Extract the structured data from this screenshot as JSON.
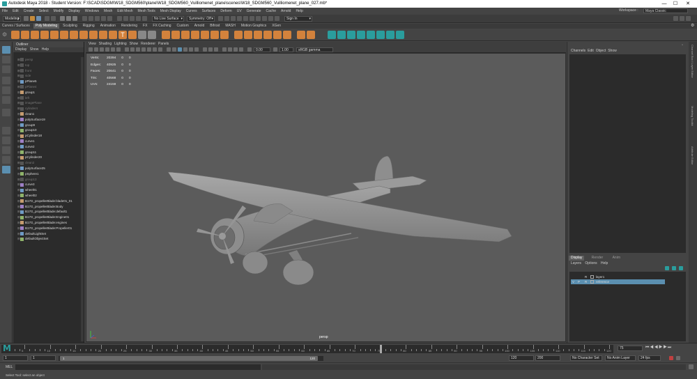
{
  "window": {
    "title": "Autodesk Maya 2018 - Student Version: F:\\SCAD\\SDGM\\W18_SDGM560\\plane\\W18_SDGM560_Vuilliomenet_plane\\scenes\\W18_SDGM560_Vuilliomenet_plane_027.mb*",
    "minimize": "—",
    "maximize": "☐",
    "close": "✕"
  },
  "menubar": [
    "File",
    "Edit",
    "Create",
    "Select",
    "Modify",
    "Display",
    "Windows",
    "Mesh",
    "Edit Mesh",
    "Mesh Tools",
    "Mesh Display",
    "Curves",
    "Surfaces",
    "Deform",
    "UV",
    "Generate",
    "Cache",
    "Arnold",
    "Help"
  ],
  "workspace": {
    "label": "Workspace :",
    "value": "Maya Classic"
  },
  "statusline": {
    "menuset": "Modeling",
    "live_surface": "No Live Surface",
    "symmetry": "Symmetry: Off",
    "signin": "Sign In"
  },
  "shelf_tabs": [
    "Curves / Surfaces",
    "Poly Modeling",
    "Sculpting",
    "Rigging",
    "Animation",
    "Rendering",
    "FX",
    "FX Caching",
    "Custom",
    "Arnold",
    "Bifrost",
    "MASH",
    "Motion Graphics",
    "XGen"
  ],
  "shelf_active": "Poly Modeling",
  "outliner": {
    "title": "Outliner",
    "menu": [
      "Display",
      "Show",
      "Help"
    ],
    "items": [
      {
        "name": "persp",
        "dim": true
      },
      {
        "name": "top",
        "dim": true
      },
      {
        "name": "front",
        "dim": true
      },
      {
        "name": "side",
        "dim": true
      },
      {
        "name": "pPlane5",
        "dim": false
      },
      {
        "name": "pPlane4",
        "dim": true
      },
      {
        "name": "group1",
        "dim": false
      },
      {
        "name": "left",
        "dim": true
      },
      {
        "name": "imagePlane",
        "dim": true
      },
      {
        "name": "cylinder4",
        "dim": true
      },
      {
        "name": "clean1",
        "dim": false
      },
      {
        "name": "polySurface19",
        "dim": false
      },
      {
        "name": "group9",
        "dim": false
      },
      {
        "name": "group10",
        "dim": false
      },
      {
        "name": "pCylinder18",
        "dim": false
      },
      {
        "name": "curve1",
        "dim": false
      },
      {
        "name": "curve2",
        "dim": false
      },
      {
        "name": "group11",
        "dim": false
      },
      {
        "name": "pCylinder20",
        "dim": false
      },
      {
        "name": "clean2",
        "dim": true
      },
      {
        "name": "polySurface25",
        "dim": false
      },
      {
        "name": "pSphere1",
        "dim": false
      },
      {
        "name": "group13",
        "dim": true
      },
      {
        "name": "curve3",
        "dim": false
      },
      {
        "name": "wheel01",
        "dim": false
      },
      {
        "name": "wheel02",
        "dim": false
      },
      {
        "name": "B17G_propellerBlade:blade01_01",
        "dim": false
      },
      {
        "name": "B17G_propellerBlade:Body",
        "dim": false
      },
      {
        "name": "B17G_propellerBlade:default1",
        "dim": false
      },
      {
        "name": "B17G_propellerBlade:Engine01",
        "dim": false
      },
      {
        "name": "B17G_propellerBlade:engines",
        "dim": false
      },
      {
        "name": "B17G_propellerBlade:Propeller01",
        "dim": false
      },
      {
        "name": "defaultLightSet",
        "dim": false
      },
      {
        "name": "defaultObjectSet",
        "dim": false
      }
    ]
  },
  "panel": {
    "menu": [
      "View",
      "Shading",
      "Lighting",
      "Show",
      "Renderer",
      "Panels"
    ],
    "exposure": "0.00",
    "gamma": "1.00",
    "colorspace": "sRGB gamma",
    "camera": "persp"
  },
  "hud": [
    {
      "label": "Verts:",
      "a": "20394",
      "b": "0",
      "c": "0"
    },
    {
      "label": "Edges:",
      "a": "40925",
      "b": "0",
      "c": "0"
    },
    {
      "label": "Faces:",
      "a": "20641",
      "b": "0",
      "c": "0"
    },
    {
      "label": "Tris:",
      "a": "40568",
      "b": "0",
      "c": "0"
    },
    {
      "label": "UVs:",
      "a": "24159",
      "b": "0",
      "c": "0"
    }
  ],
  "channelbox": {
    "menu": [
      "Channels",
      "Edit",
      "Object",
      "Show"
    ]
  },
  "layereditor": {
    "tabs": [
      "Display",
      "Render",
      "Anim"
    ],
    "menu": [
      "Layers",
      "Options",
      "Help"
    ],
    "layers": [
      {
        "v": "",
        "p": "",
        "r": "R",
        "name": "layer1",
        "selected": false
      },
      {
        "v": "V",
        "p": "P",
        "r": "R",
        "name": "reference",
        "selected": true
      }
    ]
  },
  "side_tabs": [
    "Channel Box / Layer Editor",
    "Modeling Toolkit",
    "Attribute Editor"
  ],
  "timeline": {
    "ticks": [
      "5",
      "10",
      "15",
      "20",
      "25",
      "30",
      "35",
      "40",
      "45",
      "50",
      "55",
      "60",
      "65",
      "70",
      "75",
      "80",
      "85",
      "90",
      "95",
      "100",
      "105",
      "110",
      "115",
      "120"
    ],
    "current": "75"
  },
  "range": {
    "start": "1",
    "start2": "1",
    "inner_start": "1",
    "inner_end": "120",
    "end": "120",
    "end2": "200",
    "character": "No Character Set",
    "anim_layer": "No Anim Layer",
    "fps": "24 fps"
  },
  "mel": {
    "label": "MEL",
    "help": "Select Tool: select an object"
  },
  "colors": {
    "accent": "#e08a3c",
    "selected": "#5b8fb0",
    "teal": "#2a9d9d"
  }
}
